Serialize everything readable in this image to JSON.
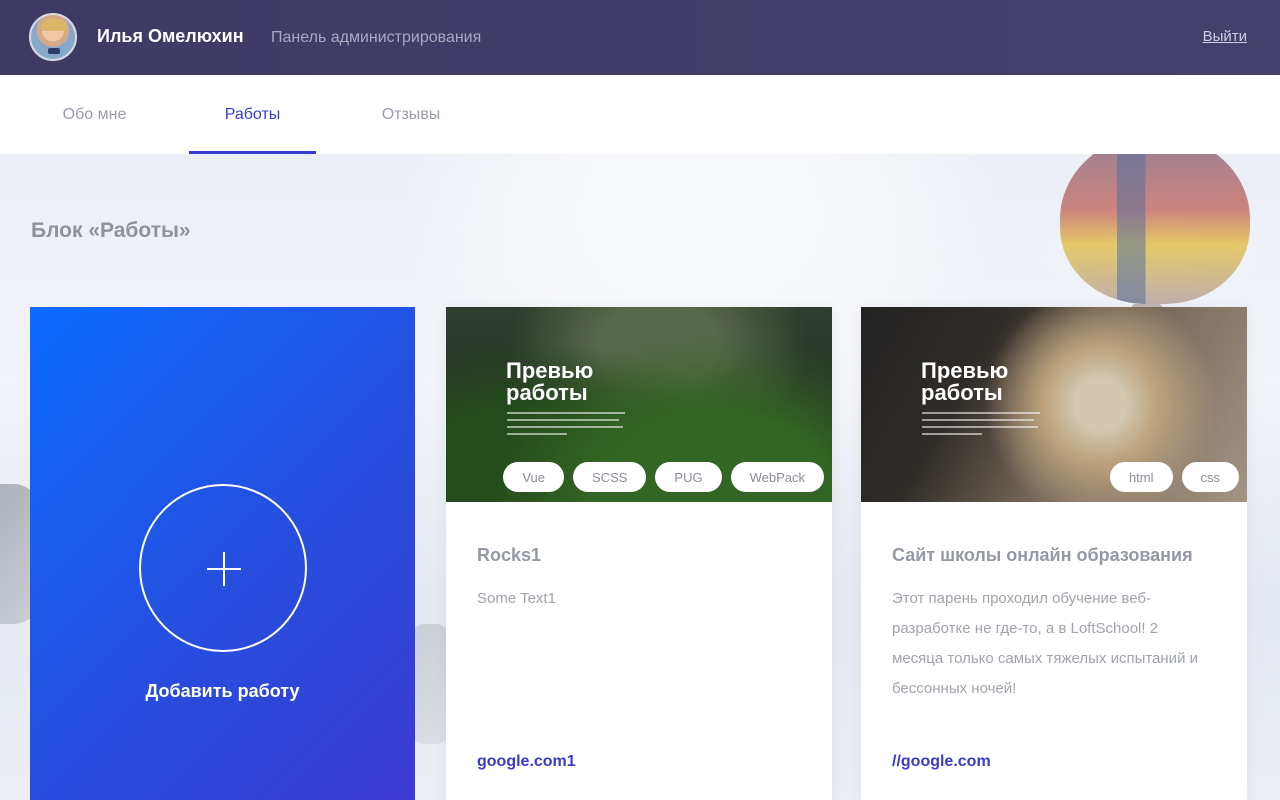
{
  "header": {
    "user_name": "Илья Омелюхин",
    "panel_title": "Панель администрирования",
    "logout_label": "Выйти"
  },
  "tabs": [
    {
      "label": "Обо мне",
      "active": false
    },
    {
      "label": "Работы",
      "active": true
    },
    {
      "label": "Отзывы",
      "active": false
    }
  ],
  "section": {
    "title": "Блок «Работы»"
  },
  "add_card": {
    "label": "Добавить работу",
    "icon": "plus-icon"
  },
  "works": [
    {
      "preview_title": "Превью работы",
      "tags": [
        "Vue",
        "SCSS",
        "PUG",
        "WebPack"
      ],
      "title": "Rocks1",
      "description": "Some Text1",
      "link": "google.com1"
    },
    {
      "preview_title": "Превью работы",
      "tags": [
        "html",
        "css"
      ],
      "title": "Сайт школы онлайн образования",
      "description": "Этот парень проходил обучение веб-разработке не где-то, а в LoftSchool! 2 месяца только самых тяжелых испытаний и бессонных ночей!",
      "link": "//google.com"
    }
  ],
  "colors": {
    "header_bg": "#3e3a64",
    "accent": "#383bcf",
    "add_card_gradient_start": "#0b6bff",
    "add_card_gradient_end": "#3c3ad0"
  }
}
